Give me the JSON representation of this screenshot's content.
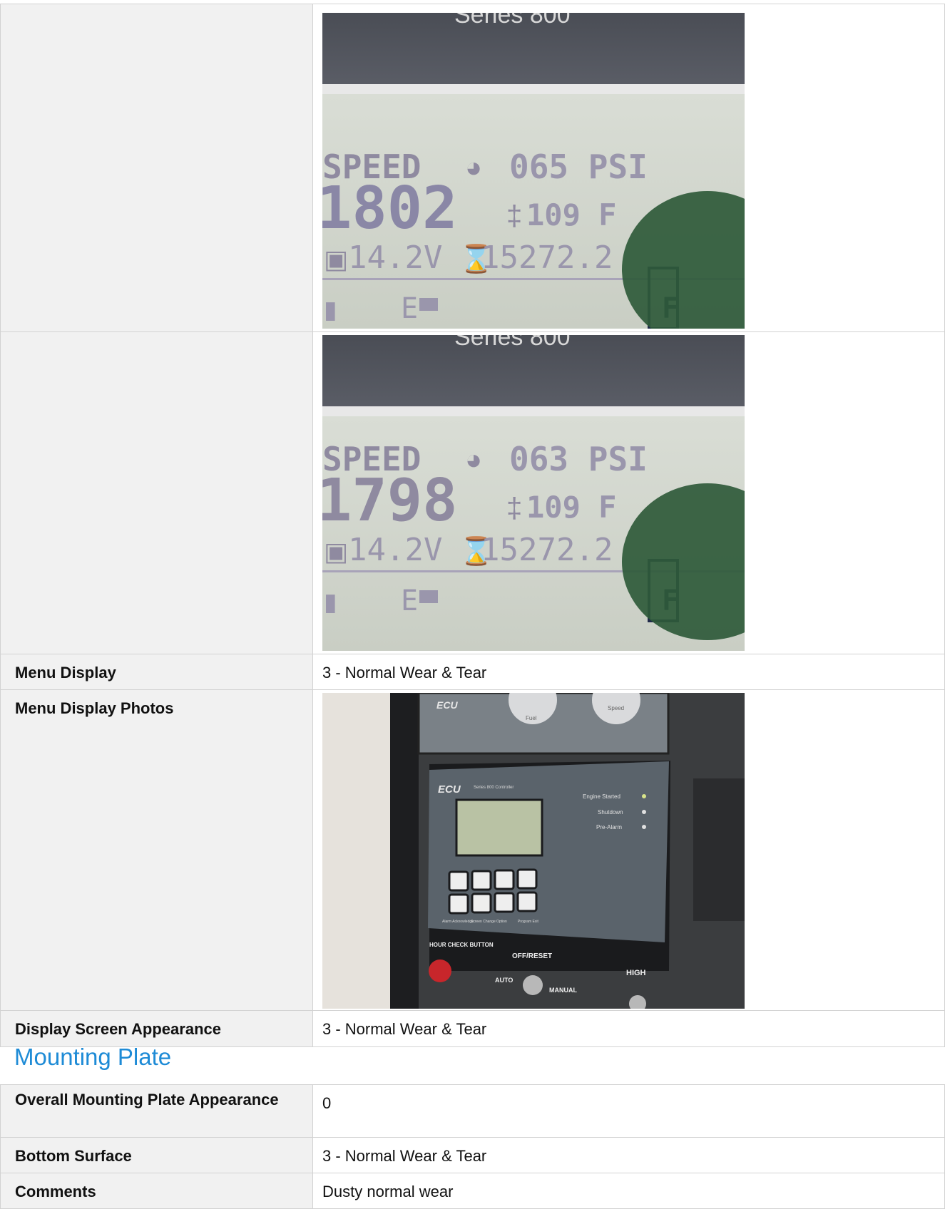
{
  "controller_rows": [
    {
      "label": "",
      "photo": {
        "brand_line": "Series 800",
        "speed_label": "SPEED",
        "speed_value": "1802",
        "oil_pressure": "065 PSI",
        "temperature": "109 F",
        "voltage": "14.2V",
        "hours": "15272.2",
        "fuel_letter_e": "E",
        "fuel_letter_f": "F"
      }
    },
    {
      "label": "",
      "photo": {
        "brand_line": "Series 800",
        "speed_label": "SPEED",
        "speed_value": "1798",
        "oil_pressure": "063 PSI",
        "temperature": "109 F",
        "voltage": "14.2V",
        "hours": "15272.2",
        "fuel_letter_e": "E",
        "fuel_letter_f": "F"
      }
    }
  ],
  "menu_display": {
    "label": "Menu Display",
    "value": "3 - Normal Wear & Tear"
  },
  "menu_display_photos": {
    "label": "Menu Display Photos",
    "photo": {
      "gauge_brand": "ECU",
      "gauge_left": "Fuel",
      "gauge_right": "Speed",
      "panel_brand": "ECU",
      "panel_subtitle": "Series 800 Controller",
      "leds": [
        "Engine Started",
        "Shutdown",
        "Pre-Alarm"
      ],
      "button_labels": [
        "Alarm Acknowledge",
        "Screen Change",
        "Option",
        "Program Exit"
      ],
      "hour_check": "HOUR CHECK BUTTON",
      "switch_off": "OFF/RESET",
      "switch_auto": "AUTO",
      "switch_manual": "MANUAL",
      "high_label": "HIGH"
    }
  },
  "display_screen_appearance": {
    "label": "Display Screen Appearance",
    "value": "3 - Normal Wear & Tear"
  },
  "mounting_plate": {
    "title": "Mounting Plate",
    "rows": [
      {
        "label": "Overall Mounting Plate Appearance",
        "value": "0"
      },
      {
        "label": "Bottom Surface",
        "value": "3 - Normal Wear & Tear"
      },
      {
        "label": "Comments",
        "value": "Dusty normal wear"
      }
    ]
  }
}
